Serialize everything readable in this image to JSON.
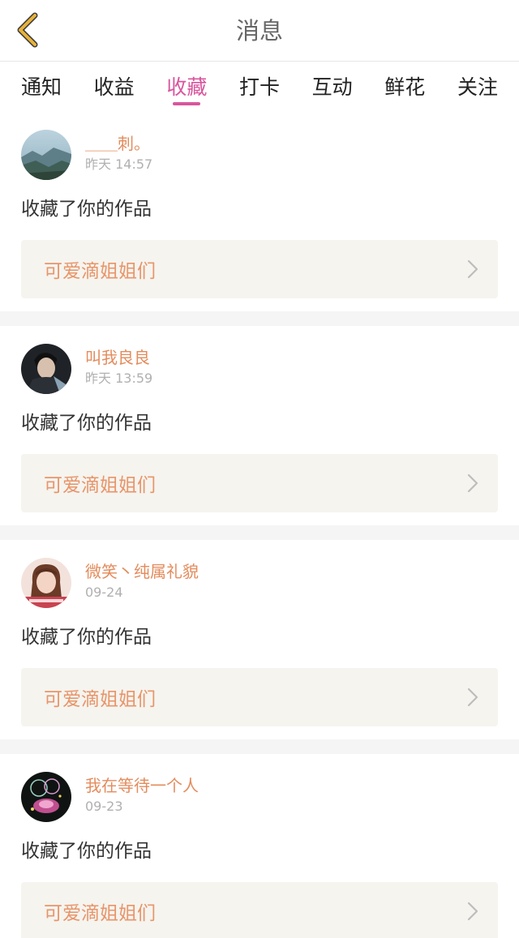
{
  "header": {
    "title": "消息",
    "back_icon": "back-chevron-icon",
    "accent_color": "#e8b23a"
  },
  "tabs": [
    {
      "label": "通知",
      "active": false
    },
    {
      "label": "收益",
      "active": false
    },
    {
      "label": "收藏",
      "active": true
    },
    {
      "label": "打卡",
      "active": false
    },
    {
      "label": "互动",
      "active": false
    },
    {
      "label": "鲜花",
      "active": false
    },
    {
      "label": "关注",
      "active": false
    }
  ],
  "active_tab_color": "#d9559d",
  "feed": [
    {
      "user": "＿＿刺。",
      "time": "昨天 14:57",
      "action": "收藏了你的作品",
      "work": "可爱滴姐姐们"
    },
    {
      "user": "叫我良良",
      "time": "昨天 13:59",
      "action": "收藏了你的作品",
      "work": "可爱滴姐姐们"
    },
    {
      "user": "微笑丶纯属礼貌",
      "time": "09-24",
      "action": "收藏了你的作品",
      "work": "可爱滴姐姐们"
    },
    {
      "user": "我在等待一个人",
      "time": "09-23",
      "action": "收藏了你的作品",
      "work": "可爱滴姐姐们"
    }
  ]
}
